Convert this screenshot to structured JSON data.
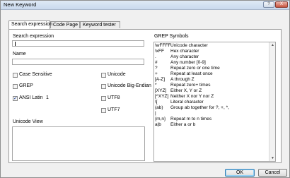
{
  "window": {
    "title": "New Keyword",
    "help_glyph": "?",
    "close_glyph": "X"
  },
  "tabs": [
    {
      "label": "Search expression"
    },
    {
      "label": "Code Page"
    },
    {
      "label": "Keyword tester"
    }
  ],
  "form": {
    "search_label": "Search expression",
    "search_value": "",
    "name_label": "Name",
    "name_value": "",
    "unicode_view_label": "Unicode View"
  },
  "options": {
    "case_sensitive": {
      "label": "Case Sensitive",
      "checked": false
    },
    "grep": {
      "label": "GREP",
      "checked": false
    },
    "ansi": {
      "label": "ANSI Latin",
      "value": "1",
      "checked": true
    },
    "unicode": {
      "label": "Unicode",
      "checked": false
    },
    "unicode_be": {
      "label": "Unicode Big-Endian",
      "checked": false
    },
    "utf8": {
      "label": "UTF8",
      "checked": false
    },
    "utf7": {
      "label": "UTF7",
      "checked": false
    }
  },
  "grep_symbols": {
    "title": "GREP Symbols",
    "rows": [
      {
        "sym": "\\wFFFF",
        "desc": "Unicode character"
      },
      {
        "sym": "\\xFF",
        "desc": "Hex character"
      },
      {
        "sym": ".",
        "desc": "Any character"
      },
      {
        "sym": "#",
        "desc": "Any number [0-9]"
      },
      {
        "sym": "?",
        "desc": "Repeat zero or one time"
      },
      {
        "sym": "+",
        "desc": "Repeat at least once"
      },
      {
        "sym": "[A-Z]",
        "desc": "A through Z"
      },
      {
        "sym": "*",
        "desc": "Repeat zero+ times"
      },
      {
        "sym": "[XYZ]",
        "desc": "Either X, Y or Z"
      },
      {
        "sym": "[^XYZ]",
        "desc": "Neither X nor Y nor Z"
      },
      {
        "sym": "\\[",
        "desc": "Literal character"
      },
      {
        "sym": "(ab)",
        "desc": "Group ab together for ?, +, *,"
      },
      {
        "sym": "|",
        "desc": ""
      },
      {
        "sym": "{m,n}",
        "desc": "Repeat m to n times"
      },
      {
        "sym": "a|b",
        "desc": "Either a or b"
      }
    ],
    "scroll_up": "▲",
    "scroll_down": "▼"
  },
  "buttons": {
    "ok": "OK",
    "cancel": "Cancel"
  },
  "check_glyph": "✓"
}
